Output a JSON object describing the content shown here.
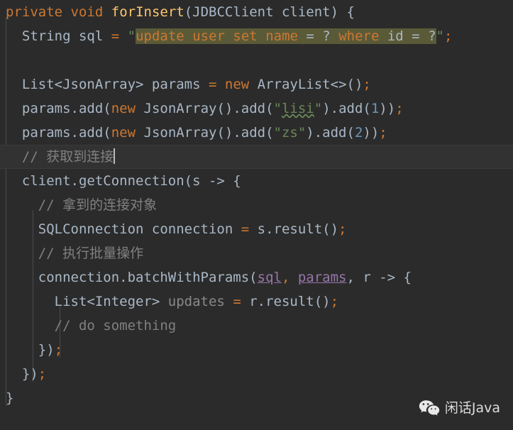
{
  "editor": {
    "background_color": "#2b2b2b",
    "caret_line_color": "#323232",
    "indent_guide_color": "#4b4b4b",
    "default_text_color": "#a9b7c6",
    "keyword_color": "#cc7832",
    "method_color": "#ffc66d",
    "string_color": "#6a8759",
    "number_color": "#6897bb",
    "comment_color": "#808080",
    "field_color": "#9876aa",
    "sql_highlight_color": "#5a5a38",
    "caret_color": "#bbbbbb"
  },
  "lines": {
    "l1": {
      "t1": "private",
      "t2": " ",
      "t3": "void",
      "t4": " ",
      "t5": "forInsert",
      "t6": "(",
      "t7": "JDBCClient",
      "t8": " client",
      "t9": ") {"
    },
    "l2": {
      "indent": "  ",
      "t1": "String",
      "t2": " sql ",
      "t3": "=",
      "t4": " ",
      "quote_open": "\"",
      "sql_update": "update",
      "sql_sp1": " ",
      "sql_user": "user",
      "sql_sp2": " ",
      "sql_set": "set",
      "sql_sp3": " ",
      "sql_name": "name",
      "sql_eq1": " = ",
      "sql_q1": "?",
      "sql_sp4": " ",
      "sql_where": "where",
      "sql_sp5": " ",
      "sql_id": "id",
      "sql_eq2": " = ",
      "sql_q2": "?",
      "quote_close": "\"",
      "t_end": ";"
    },
    "l3": {
      "text": ""
    },
    "l4": {
      "indent": "  ",
      "t1": "List<JsonArray> params ",
      "t2": "=",
      "t3": " ",
      "t4": "new",
      "t5": " ArrayList<>()",
      "t6": ";"
    },
    "l5": {
      "indent": "  ",
      "t1": "params.add(",
      "t2": "new",
      "t3": " JsonArray().add(",
      "q1": "\"",
      "typo": "lisi",
      "q2": "\"",
      "t4": ").add(",
      "num": "1",
      "t5": "))",
      "t6": ";"
    },
    "l6": {
      "indent": "  ",
      "t1": "params.add(",
      "t2": "new",
      "t3": " JsonArray().add(",
      "str": "\"zs\"",
      "t4": ").add(",
      "num": "2",
      "t5": "))",
      "t6": ";"
    },
    "l7": {
      "indent": "  ",
      "comment": "// 获取到连接",
      "has_caret": true
    },
    "l8": {
      "indent": "  ",
      "t1": "client.getConnection(s -> {"
    },
    "l9": {
      "indent": "    ",
      "comment": "// 拿到的连接对象"
    },
    "l10": {
      "indent": "    ",
      "t1": "SQLConnection connection ",
      "t2": "=",
      "t3": " s.result()",
      "t4": ";"
    },
    "l11": {
      "indent": "    ",
      "comment": "// 执行批量操作"
    },
    "l12": {
      "indent": "    ",
      "t1": "connection.batchWithParams(",
      "v1": "sql",
      "t2": ", ",
      "v2": "params",
      "t3": ", r -> {"
    },
    "l13": {
      "indent": "      ",
      "t1": "List<Integer> ",
      "unused": "updates",
      "t2": " ",
      "t3": "=",
      "t4": " r.result()",
      "t5": ";"
    },
    "l14": {
      "indent": "      ",
      "comment": "// do something"
    },
    "l15": {
      "indent": "    ",
      "t1": "})",
      "t2": ";"
    },
    "l16": {
      "indent": "  ",
      "t1": "})",
      "t2": ";"
    },
    "l17": {
      "t1": "}"
    }
  },
  "watermark": {
    "icon": "wechat-icon",
    "label": "闲话Java",
    "text_color": "#dcdcdc"
  }
}
